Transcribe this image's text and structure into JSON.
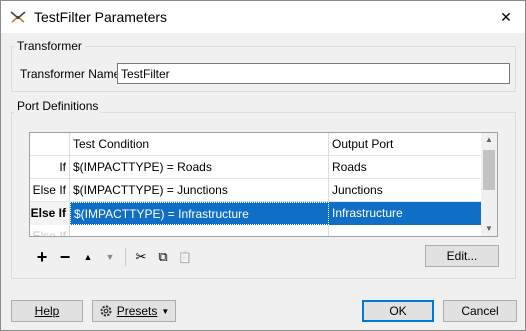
{
  "window": {
    "title": "TestFilter Parameters"
  },
  "transformer": {
    "group_label": "Transformer",
    "name_label": "Transformer Name:",
    "name_value": "TestFilter"
  },
  "ports": {
    "group_label": "Port Definitions",
    "columns": {
      "if": "",
      "condition": "Test Condition",
      "output": "Output Port"
    },
    "rows": [
      {
        "if": "If",
        "condition": "$(IMPACTTYPE) = Roads",
        "output": "Roads"
      },
      {
        "if": "Else If",
        "condition": "$(IMPACTTYPE) = Junctions",
        "output": "Junctions"
      },
      {
        "if": "Else If",
        "condition": "$(IMPACTTYPE) = Infrastructure",
        "output": "Infrastructure"
      },
      {
        "if": "Else If",
        "condition": "",
        "output": ""
      }
    ],
    "selected_row": 2
  },
  "toolbar": {
    "add": "+",
    "remove": "−",
    "move_up": "▲",
    "move_down": "▼",
    "cut": "✂",
    "copy": "⧉",
    "paste": "📋",
    "edit_label": "Edit..."
  },
  "footer": {
    "help_label": "Help",
    "presets_label": "Presets",
    "ok_label": "OK",
    "cancel_label": "Cancel"
  },
  "icons": {
    "app": "filter-wrench-icon",
    "close": "close-icon",
    "gear": "gear-icon",
    "caret": "caret-down-icon"
  },
  "colors": {
    "selection": "#0f6fc6",
    "default_button_border": "#0078d7"
  }
}
